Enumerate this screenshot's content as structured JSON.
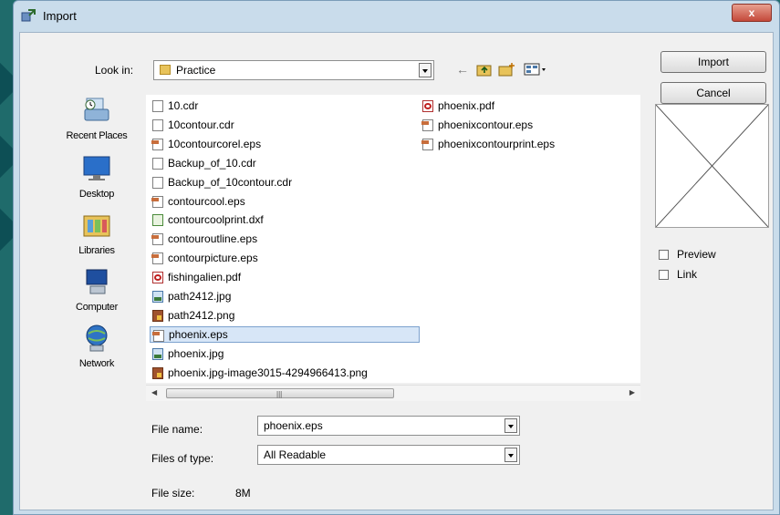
{
  "window": {
    "title": "Import",
    "close_label": "x"
  },
  "look_in": {
    "label": "Look in:",
    "value": "Practice"
  },
  "toolbar": {
    "back_icon": "back-arrow-icon",
    "up_icon": "up-folder-icon",
    "new_folder_icon": "new-folder-icon",
    "view_menu_icon": "view-menu-icon"
  },
  "places": [
    {
      "label": "Recent Places",
      "icon": "recent-places-icon"
    },
    {
      "label": "Desktop",
      "icon": "desktop-icon"
    },
    {
      "label": "Libraries",
      "icon": "libraries-icon"
    },
    {
      "label": "Computer",
      "icon": "computer-icon"
    },
    {
      "label": "Network",
      "icon": "network-icon"
    }
  ],
  "files_col1": [
    {
      "name": "10.cdr",
      "type": "doc"
    },
    {
      "name": "10contour.cdr",
      "type": "doc"
    },
    {
      "name": "10contourcorel.eps",
      "type": "eps"
    },
    {
      "name": "Backup_of_10.cdr",
      "type": "doc"
    },
    {
      "name": "Backup_of_10contour.cdr",
      "type": "doc"
    },
    {
      "name": "contourcool.eps",
      "type": "eps"
    },
    {
      "name": "contourcoolprint.dxf",
      "type": "dxf"
    },
    {
      "name": "contouroutline.eps",
      "type": "eps"
    },
    {
      "name": "contourpicture.eps",
      "type": "eps"
    },
    {
      "name": "fishingalien.pdf",
      "type": "pdf"
    },
    {
      "name": "path2412.jpg",
      "type": "jpg"
    },
    {
      "name": "path2412.png",
      "type": "png"
    },
    {
      "name": "phoenix.eps",
      "type": "eps",
      "selected": true
    },
    {
      "name": "phoenix.jpg",
      "type": "jpg"
    },
    {
      "name": "phoenix.jpg-image3015-4294966413.png",
      "type": "png"
    }
  ],
  "files_col2": [
    {
      "name": "phoenix.pdf",
      "type": "pdf"
    },
    {
      "name": "phoenixcontour.eps",
      "type": "eps"
    },
    {
      "name": "phoenixcontourprint.eps",
      "type": "eps"
    }
  ],
  "file_name": {
    "label": "File name:",
    "value": "phoenix.eps"
  },
  "files_of_type": {
    "label": "Files of type:",
    "value": "All Readable"
  },
  "file_size": {
    "label": "File size:",
    "value": "8M"
  },
  "buttons": {
    "import": "Import",
    "cancel": "Cancel"
  },
  "options": {
    "preview": "Preview",
    "link": "Link"
  }
}
